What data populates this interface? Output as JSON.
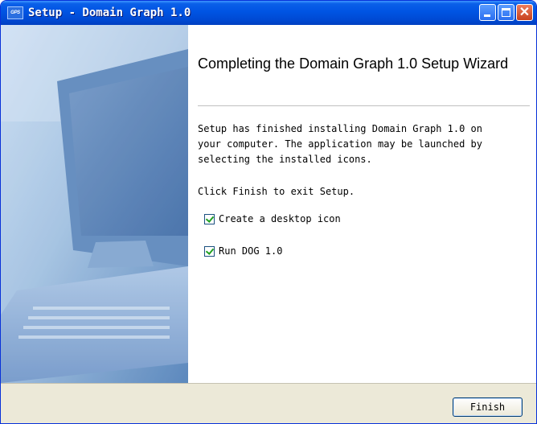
{
  "window": {
    "title": "Setup - Domain Graph 1.0",
    "icon_label": "GPS",
    "icon": "app-icon"
  },
  "wizard": {
    "heading": "Completing the Domain Graph 1.0 Setup Wizard",
    "description": "Setup has finished installing Domain Graph 1.0 on\nyour computer. The application may be launched by\nselecting the installed icons.",
    "instruction": "Click Finish to exit Setup.",
    "options": [
      {
        "label": "Create a desktop icon",
        "checked": true
      },
      {
        "label": "Run DOG 1.0",
        "checked": true
      }
    ],
    "finish_label": "Finish"
  },
  "colors": {
    "titlebar": "#0054e3",
    "accent": "#2a6ef0",
    "close": "#c8401d",
    "checkmark": "#21a121"
  }
}
